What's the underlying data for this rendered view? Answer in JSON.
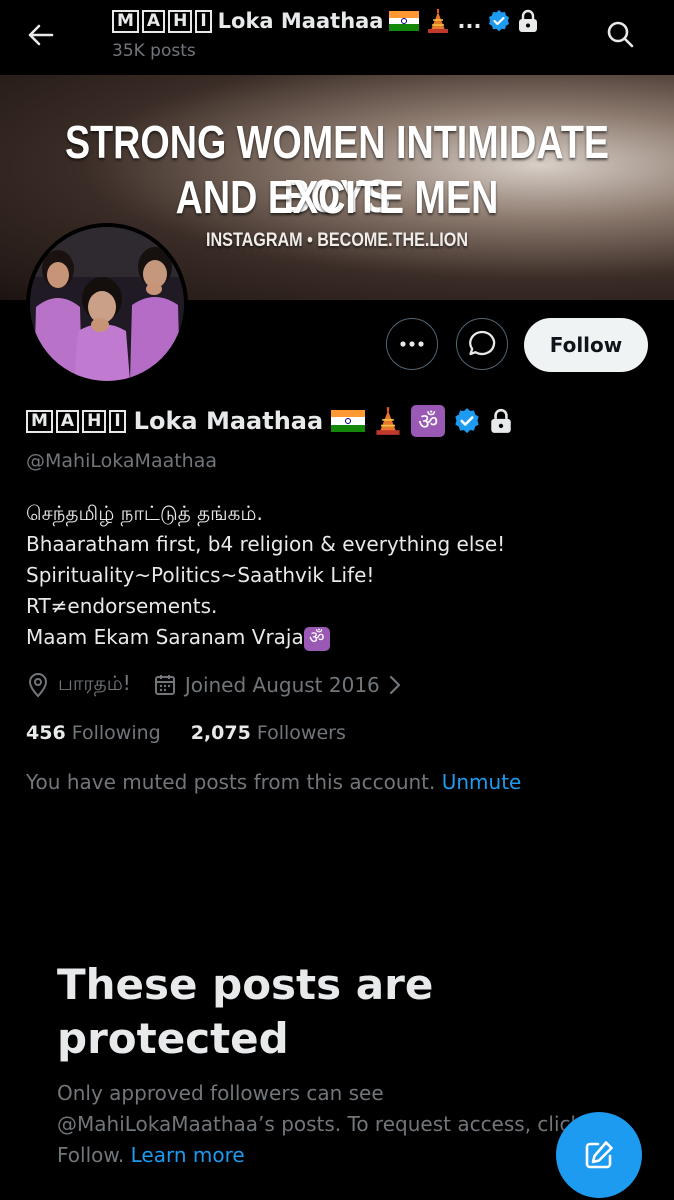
{
  "header": {
    "boxed_letters": [
      "M",
      "A",
      "H",
      "I"
    ],
    "title": "Loka Maathaa",
    "ellipsis": "...",
    "subtitle": "35K posts"
  },
  "banner": {
    "line1": "STRONG WOMEN INTIMIDATE BOYS",
    "line2": "AND EXCITE MEN",
    "line3": "INSTAGRAM • BECOME.THE.LION"
  },
  "actions": {
    "follow_label": "Follow"
  },
  "profile": {
    "boxed_letters": [
      "M",
      "A",
      "H",
      "I"
    ],
    "name": "Loka Maathaa",
    "om_symbol": "ॐ",
    "handle": "@MahiLokaMaathaa",
    "bio": [
      "செந்தமிழ் நாட்டுத் தங்கம்.",
      "Bhaaratham first, b4 religion & everything else!",
      "Spirituality~Politics~Saathvik Life!",
      "RT≠endorsements.",
      "Maam Ekam Saranam Vraja"
    ],
    "location": "பாரதம்!",
    "joined": "Joined August 2016",
    "following_count": "456",
    "following_label": "Following",
    "followers_count": "2,075",
    "followers_label": "Followers",
    "muted_text": "You have muted posts from this account.",
    "unmute_label": "Unmute"
  },
  "protected": {
    "title_line1": "These posts are",
    "title_line2": "protected",
    "line1": "Only approved followers can see",
    "line2": "@MahiLokaMaathaa’s posts. To request access, click",
    "line3_prefix": "Follow.",
    "learn_more": "Learn more"
  },
  "colors": {
    "accent": "#1d9bf0",
    "background": "#000000",
    "secondary_text": "#71767b",
    "om_badge": "#9b59b6"
  },
  "icons": [
    "back-arrow-icon",
    "search-icon",
    "more-icon",
    "message-icon",
    "verified-badge-icon",
    "lock-icon",
    "india-flag-icon",
    "temple-icon",
    "om-icon",
    "location-icon",
    "calendar-icon",
    "chevron-right-icon",
    "compose-icon"
  ]
}
